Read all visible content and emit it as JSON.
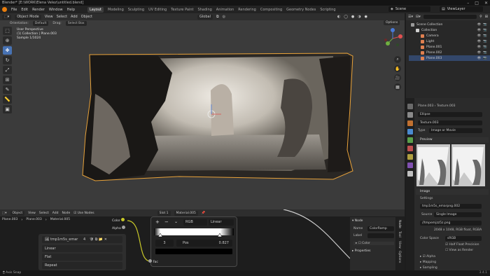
{
  "titlebar": {
    "title": "Blender* [E:\\WORK\\Elena Velez\\untitled.blend]",
    "min": "–",
    "max": "□",
    "close": "✕"
  },
  "menu": {
    "items": [
      "File",
      "Edit",
      "Render",
      "Window",
      "Help"
    ],
    "workspaces": [
      "Layout",
      "Modeling",
      "Sculpting",
      "UV Editing",
      "Texture Paint",
      "Shading",
      "Animation",
      "Rendering",
      "Compositing",
      "Geometry Nodes",
      "Scripting"
    ],
    "active_workspace": "Layout",
    "scene": "Scene",
    "view_layer": "ViewLayer"
  },
  "viewport": {
    "mode": "Object Mode",
    "menus": [
      "View",
      "Select",
      "Add",
      "Object"
    ],
    "transform": "Global",
    "orientation_label": "Orientation:",
    "orientation": "Default",
    "drag_label": "Drag:",
    "drag": "Select Box",
    "options": "Options",
    "info": [
      "User Perspective",
      "(1) Collection | Plane.003",
      "Sample 1/1024"
    ]
  },
  "outliner": {
    "rows": [
      {
        "name": "Scene Collection",
        "indent": 0,
        "color": "#9a9a9a",
        "selected": false
      },
      {
        "name": "Collection",
        "indent": 1,
        "color": "#d0d0d0",
        "selected": false
      },
      {
        "name": "Camera",
        "indent": 2,
        "color": "#e08050",
        "selected": false
      },
      {
        "name": "Light",
        "indent": 2,
        "color": "#e08050",
        "selected": false
      },
      {
        "name": "Plane.001",
        "indent": 2,
        "color": "#e08050",
        "selected": false
      },
      {
        "name": "Plane.002",
        "indent": 2,
        "color": "#e08050",
        "selected": false
      },
      {
        "name": "Plane.003",
        "indent": 2,
        "color": "#e08050",
        "selected": true
      }
    ]
  },
  "properties": {
    "breadcrumb_obj": "Plane.003",
    "breadcrumb_tex": "Texture.003",
    "ellipse": "Ellipse",
    "texture_name": "Texture.003",
    "type_label": "Type",
    "type_value": "Image or Movie",
    "preview_label": "Preview",
    "image_label": "Image",
    "settings_label": "Settings",
    "image_file": "tmp1m5s_emarpng.002",
    "source_label": "Source",
    "source_value": "Single Image",
    "filepath": "//tmpemjzz5z.png",
    "info": "2048 x 1048, RGB float, RGBA",
    "colorspace_label": "Color Space",
    "colorspace": "sRGB",
    "half_float": "Half Float Precision",
    "view_render": "View as Render",
    "alpha": "Alpha",
    "mapping": "Mapping",
    "sampling": "Sampling"
  },
  "node_editor": {
    "mode": "Object",
    "menus": [
      "View",
      "Select",
      "Add",
      "Node"
    ],
    "use_nodes": "Use Nodes",
    "slot": "Slot 1",
    "material": "Material.005",
    "breadcrumb": [
      "Plane.003",
      "Plane.003",
      "Material.005"
    ],
    "image_node": {
      "name": "tmp1m5s_emar",
      "users": "4",
      "interpolation": "Linear",
      "projection": "Flat",
      "extension": "Repeat"
    },
    "sockets": {
      "color": "Color",
      "alpha": "Alpha"
    },
    "colorramp": {
      "add": "+",
      "remove": "−",
      "mode": "RGB",
      "interp": "Linear",
      "index": "3",
      "pos_label": "Pos",
      "pos_value": "0.827",
      "fac": "Fac"
    },
    "panel": {
      "node_title": "Node",
      "name_label": "Name",
      "name_value": "ColorRamp",
      "label_label": "Label",
      "color_label": "Color",
      "properties_label": "Properties"
    },
    "side_tabs": [
      "Node",
      "Tool",
      "View",
      "Options"
    ]
  },
  "status": {
    "left": "Axis Snap",
    "version": "3.4.1"
  },
  "colors": {
    "accent": "#4772b3",
    "selected_outline": "#e8a23a",
    "orange": "#e87d0d"
  }
}
